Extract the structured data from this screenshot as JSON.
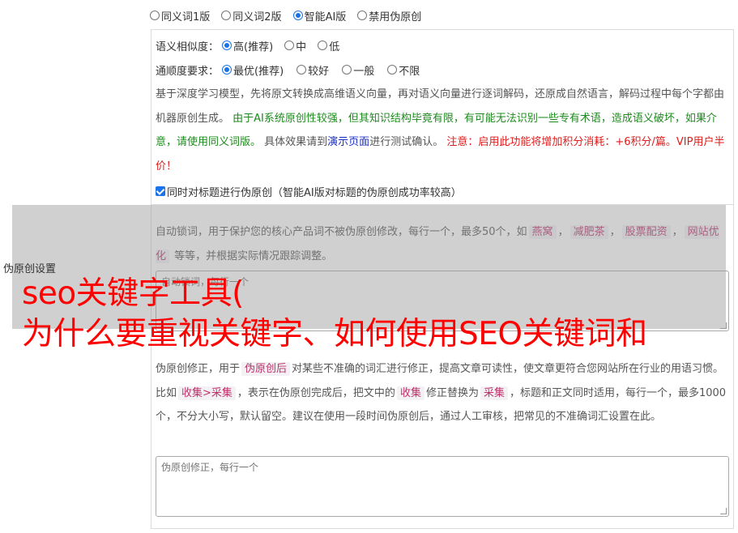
{
  "top_modes": {
    "options": [
      "同义词1版",
      "同义词2版",
      "智能AI版",
      "禁用伪原创"
    ],
    "selected_index": 2
  },
  "similarity": {
    "label": "语义相似度：",
    "options": [
      "高(推荐)",
      "中",
      "低"
    ],
    "selected_index": 0
  },
  "fluency": {
    "label": "通顺度要求：",
    "options": [
      "最优(推荐)",
      "较好",
      "一般",
      "不限"
    ],
    "selected_index": 0
  },
  "description": {
    "part1": "基于深度学习模型，先将原文转换成高维语义向量，再对语义向量进行逐词解码，还原成自然语言，解码过程中每个字都由机器原创生成。",
    "green_note": "由于AI系统原创性较强，但其知识结构毕竟有限，有可能无法识别一些专有术语，造成语义破坏，如果介意，请使用同义词版。",
    "part2": "具体效果请到",
    "demo_link": "演示页面",
    "part3": "进行测试确认。",
    "red_note": "注意：启用此功能将增加积分消耗：+6积分/篇。VIP用户半价！"
  },
  "title_option": {
    "checked": true,
    "label": "同时对标题进行伪原创（智能AI版对标题的伪原创成功率较高）"
  },
  "lock_words": {
    "text1": "自动锁词，用于保护您的核心产品词不被伪原创修改，每行一个，最多50个，如",
    "examples": [
      "燕窝",
      "减肥茶",
      "股票配资",
      "网站优化"
    ],
    "sep": "，",
    "text2": "等等，并根据实际情况跟踪调整。",
    "placeholder": "自动锁词，每行一个"
  },
  "side_label": "伪原创设置",
  "overlay_title": {
    "line1": "seo关键字工具(",
    "line2": "为什么要重视关键字、如何使用SEO关键词和"
  },
  "correction": {
    "text1": "伪原创修正，用于",
    "tag1": "伪原创后",
    "text2": "对某些不准确的词汇进行修正，提高文章可读性，使文章更符合您网站所在行业的用语习惯。比如",
    "tag2": "收集>采集",
    "text3": "，表示在伪原创完成后，把文中的",
    "tag3": "收集",
    "text4": "修正替换为",
    "tag4": "采集",
    "text5": "，标题和正文同时适用，每行一个，最多1000个，不分大小写，默认留空。建议在使用一段时间伪原创后，通过人工审核，把常见的不准确词汇设置在此。",
    "placeholder": "伪原创修正，每行一个"
  },
  "colors": {
    "accent": "#1a73e8",
    "green_note": "#1e8a1e",
    "red_note": "#e21b1b",
    "link": "#1b2fc4",
    "overlay_title": "#ff0000"
  }
}
